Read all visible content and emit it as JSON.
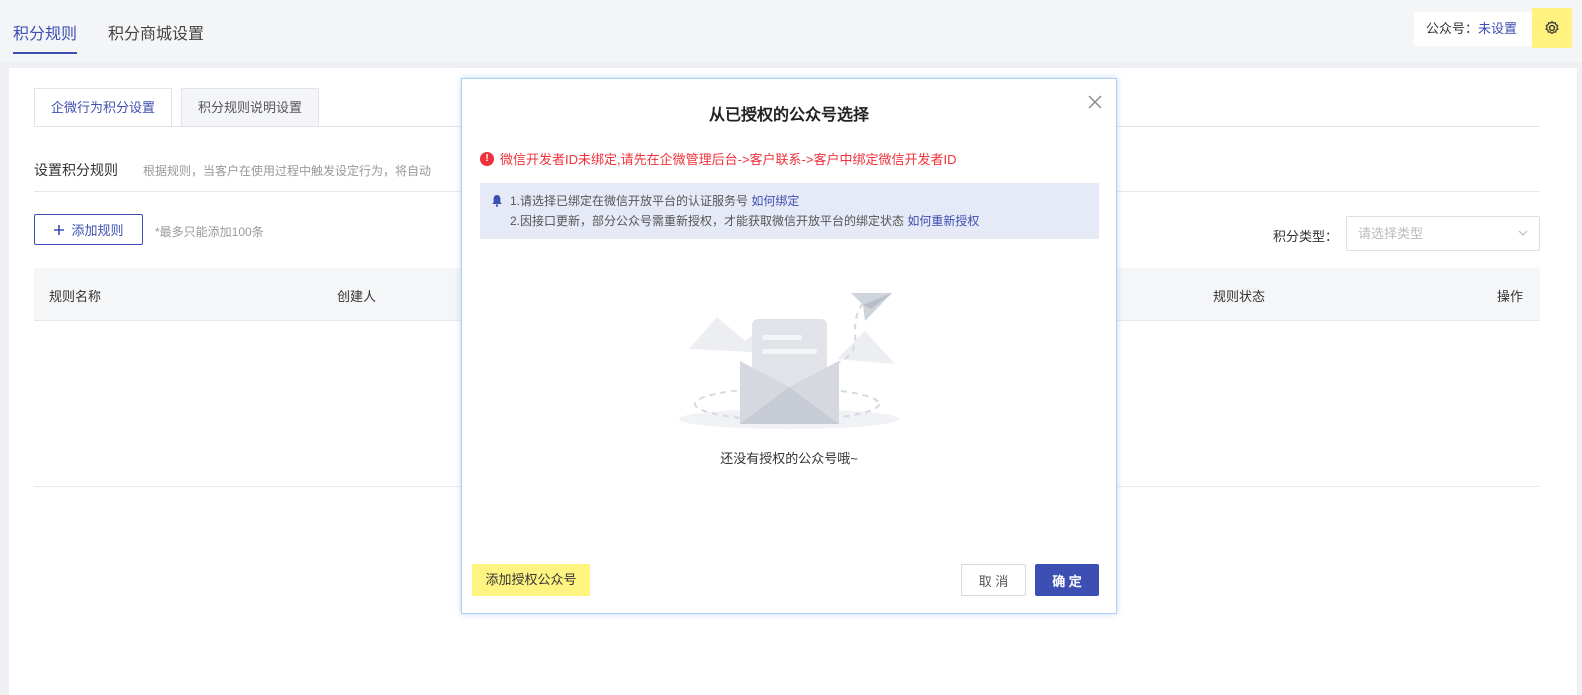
{
  "top_tabs": [
    {
      "label": "积分规则",
      "active": true
    },
    {
      "label": "积分商城设置",
      "active": false
    }
  ],
  "account": {
    "label": "公众号：",
    "value": "未设置"
  },
  "sub_tabs": [
    {
      "label": "企微行为积分设置",
      "active": true
    },
    {
      "label": "积分规则说明设置",
      "active": false
    }
  ],
  "section": {
    "title": "设置积分规则",
    "desc": "根据规则，当客户在使用过程中触发设定行为，将自动"
  },
  "add_rule": {
    "label": "添加规则",
    "hint": "*最多只能添加100条"
  },
  "filter": {
    "label": "积分类型：",
    "placeholder": "请选择类型"
  },
  "table": {
    "columns": [
      "规则名称",
      "创建人",
      "规则状态",
      "操作"
    ]
  },
  "modal": {
    "title": "从已授权的公众号选择",
    "error": "微信开发者ID未绑定,请先在企微管理后台->客户联系->客户中绑定微信开发者ID",
    "notice_line1": "1.请选择已绑定在微信开放平台的认证服务号",
    "notice_link1": "如何绑定",
    "notice_line2": "2.因接口更新，部分公众号需重新授权，才能获取微信开放平台的绑定状态",
    "notice_link2": "如何重新授权",
    "empty_text": "还没有授权的公众号哦~",
    "add_auth": "添加授权公众号",
    "cancel": "取 消",
    "ok": "确 定"
  },
  "colors": {
    "primary": "#3d4fb2",
    "error": "#f0313b",
    "highlight": "#fff382"
  }
}
